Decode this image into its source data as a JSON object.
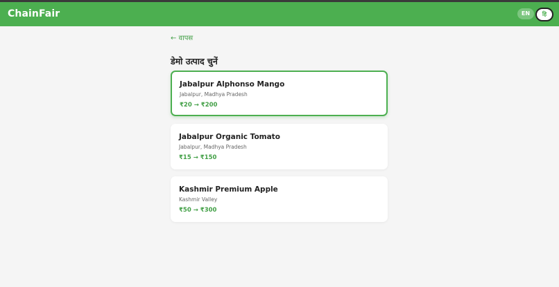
{
  "header": {
    "brand": "ChainFair",
    "lang_en": "EN",
    "lang_hi": "हि"
  },
  "nav": {
    "back": "← वापस"
  },
  "main": {
    "title": "डेमो उत्पाद चुनें",
    "products": [
      {
        "name": "Jabalpur Alphonso Mango",
        "location": "Jabalpur, Madhya Pradesh",
        "price": "₹20 → ₹200",
        "selected": true
      },
      {
        "name": "Jabalpur Organic Tomato",
        "location": "Jabalpur, Madhya Pradesh",
        "price": "₹15 → ₹150",
        "selected": false
      },
      {
        "name": "Kashmir Premium Apple",
        "location": "Kashmir Valley",
        "price": "₹50 → ₹300",
        "selected": false
      }
    ]
  },
  "colors": {
    "brand_green": "#4caf50",
    "accent_green": "#43a047",
    "page_background": "#f5f5f5"
  }
}
